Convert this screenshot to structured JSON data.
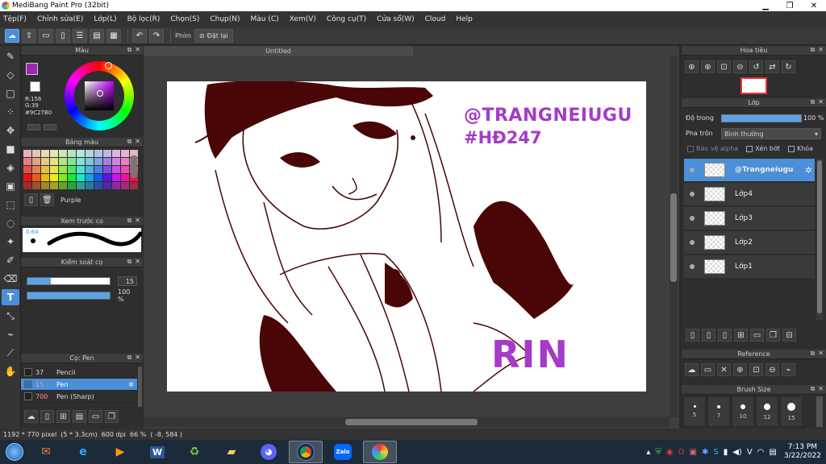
{
  "window": {
    "title": "MediBang Paint Pro (32bit)",
    "minimize": "▁",
    "maximize": "❐",
    "close": "✕"
  },
  "menu": [
    "Tệp(F)",
    "Chỉnh sửa(E)",
    "Lớp(L)",
    "Bộ lọc(R)",
    "Chọn(S)",
    "Chụp(N)",
    "Màu (C)",
    "Xem(V)",
    "Công cụ(T)",
    "Cửa sổ(W)",
    "Cloud",
    "Help"
  ],
  "toolbar": {
    "phim_label": "Phím",
    "reset_label": "Đặt lại"
  },
  "color_panel": {
    "title": "Màu",
    "r": "R:156",
    "g": "G:39",
    "hex": "#9C27B0",
    "primary_color": "#9c27b0",
    "secondary_color": "#ffffff"
  },
  "palette_panel": {
    "title": "Bảng màu",
    "selected_name": "Purple"
  },
  "preview_panel": {
    "title": "Xem trước cọ",
    "size_label": "0.64"
  },
  "control_panel": {
    "title": "Kiểm soát cọ",
    "size_value": "15",
    "opacity_value": "100 %",
    "size_fraction": 0.28,
    "opacity_fraction": 1.0
  },
  "brush_panel": {
    "title": "Cọ: Pen",
    "items": [
      {
        "size": "37",
        "name": "Pencil",
        "selected": false
      },
      {
        "size": "15",
        "name": "Pen",
        "selected": true
      },
      {
        "size": "700",
        "name": "Pen (Sharp)",
        "selected": false
      }
    ]
  },
  "document": {
    "tab_title": "Untitled"
  },
  "artwork": {
    "watermark_line1": "@TRANGNEIUGU",
    "watermark_line2": "#HĐ247",
    "caption": "RIN",
    "text_color": "#a63ac7",
    "ink_color": "#4a0606"
  },
  "navigator_panel": {
    "title": "Hoa tiêu"
  },
  "layer_panel": {
    "title": "Lớp",
    "opacity_label": "Độ trong",
    "opacity_value": "100 %",
    "blend_label": "Pha trộn",
    "blend_value": "Bình thường",
    "protect_alpha": "Bảo vệ alpha",
    "clip": "Xén bớt",
    "lock": "Khóa",
    "layers": [
      {
        "name": "@Trangneiugu",
        "selected": true
      },
      {
        "name": "Lớp4",
        "selected": false
      },
      {
        "name": "Lớp3",
        "selected": false
      },
      {
        "name": "Lớp2",
        "selected": false
      },
      {
        "name": "Lớp1",
        "selected": false
      }
    ]
  },
  "reference_panel": {
    "title": "Reference"
  },
  "brush_size_panel": {
    "title": "Brush Size",
    "sizes": [
      "5",
      "7",
      "10",
      "12",
      "15"
    ]
  },
  "status": {
    "text": "1192 * 770 pixel  (5 * 3.3cm)  600 dpi  66 %  ( -8, 584 )"
  },
  "taskbar": {
    "time": "7:13 PM",
    "date": "3/22/2022"
  }
}
